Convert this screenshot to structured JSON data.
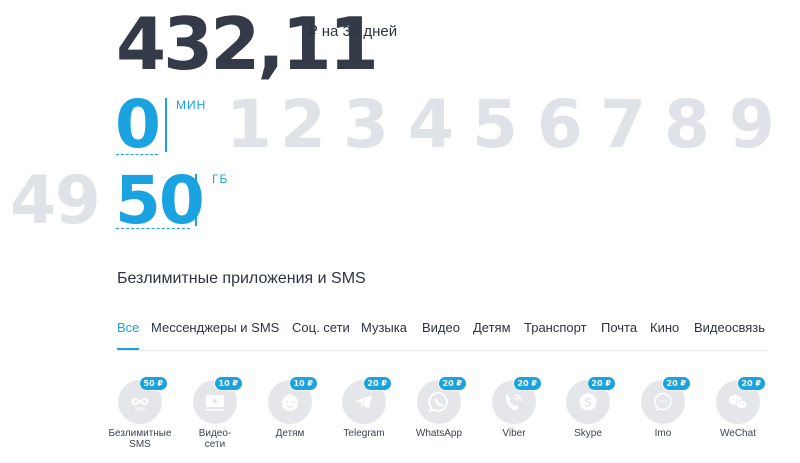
{
  "price": {
    "value": "432,11",
    "unit": "₽ на 30 дней"
  },
  "minutes": {
    "value": "0",
    "unit": "МИН",
    "ghost_digits": [
      "1",
      "2",
      "3",
      "4",
      "5",
      "6",
      "7",
      "8",
      "9"
    ]
  },
  "gigabytes": {
    "value": "50",
    "unit": "ГБ",
    "ghost_prev": "49"
  },
  "apps_section": {
    "title": "Безлимитные приложения и SMS",
    "tabs": [
      {
        "label": "Все",
        "active": true
      },
      {
        "label": "Мессенджеры и SMS",
        "active": false
      },
      {
        "label": "Соц. сети",
        "active": false
      },
      {
        "label": "Музыка",
        "active": false
      },
      {
        "label": "Видео",
        "active": false
      },
      {
        "label": "Детям",
        "active": false
      },
      {
        "label": "Транспорт",
        "active": false
      },
      {
        "label": "Почта",
        "active": false
      },
      {
        "label": "Кино",
        "active": false
      },
      {
        "label": "Видеосвязь",
        "active": false
      }
    ],
    "apps": [
      {
        "label": "Безлимитные\nSMS",
        "price": "50 ₽",
        "icon": "infinity-sms-icon"
      },
      {
        "label": "Видео-\nсети",
        "price": "10 ₽",
        "icon": "video-player-icon"
      },
      {
        "label": "Детям",
        "price": "10 ₽",
        "icon": "baby-face-icon"
      },
      {
        "label": "Telegram",
        "price": "20 ₽",
        "icon": "telegram-icon"
      },
      {
        "label": "WhatsApp",
        "price": "20 ₽",
        "icon": "whatsapp-icon"
      },
      {
        "label": "Viber",
        "price": "20 ₽",
        "icon": "viber-icon"
      },
      {
        "label": "Skype",
        "price": "20 ₽",
        "icon": "skype-icon"
      },
      {
        "label": "Imo",
        "price": "20 ₽",
        "icon": "imo-icon"
      },
      {
        "label": "WeChat",
        "price": "20 ₽",
        "icon": "wechat-icon"
      }
    ]
  },
  "colors": {
    "accent": "#1aa3e0",
    "ghost": "#dfe2e6",
    "icon_bg": "#e4e6ea",
    "price_text": "#343a48"
  }
}
